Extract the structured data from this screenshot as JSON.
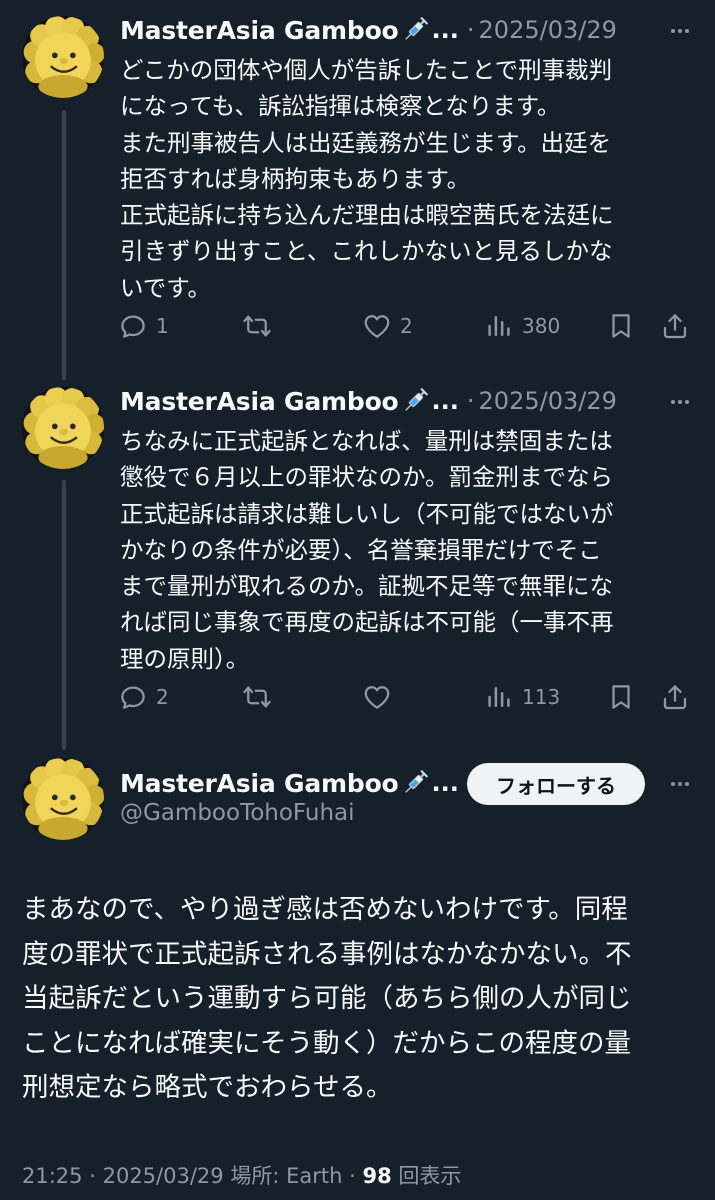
{
  "posts": [
    {
      "author_name": "MasterAsia Gamboo",
      "truncation": "...",
      "separator": "·",
      "date": "2025/03/29",
      "text": "どこかの団体や個人が告訴したことで刑事裁判\nになっても、訴訟指揮は検察となります。\nまた刑事被告人は出廷義務が生じます。出廷を\n拒否すれば身柄拘束もあります。\n正式起訴に持ち込んだ理由は暇空茜氏を法廷に\n引きずり出すこと、これしかないと見るしかな\nいです。",
      "replies": "1",
      "reposts": "",
      "likes": "2",
      "views": "380"
    },
    {
      "author_name": "MasterAsia Gamboo",
      "truncation": "...",
      "separator": "·",
      "date": "2025/03/29",
      "text": "ちなみに正式起訴となれば、量刑は禁固または\n懲役で６月以上の罪状なのか。罰金刑までなら\n正式起訴は請求は難しいし（不可能ではないが\nかなりの条件が必要）、名誉棄損罪だけでそこ\nまで量刑が取れるのか。証拠不足等で無罪にな\nれば同じ事象で再度の起訴は不可能（一事不再\n理の原則）。",
      "replies": "2",
      "reposts": "",
      "likes": "",
      "views": "113"
    }
  ],
  "main_post": {
    "author_name": "MasterAsia Gamboo",
    "truncation": "...",
    "handle": "@GambooTohoFuhai",
    "follow_label": "フォローする",
    "text": "まあなので、やり過ぎ感は否めないわけです。同程\n度の罪状で正式起訴される事例はなかなかない。不\n当起訴だという運動すら可能（あちら側の人が同じ\nことになれば確実にそう動く）だからこの程度の量\n刑想定なら略式でおわらせる。",
    "time": "21:25",
    "separator": "·",
    "date": "2025/03/29",
    "location": "場所: Earth",
    "separator2": "·",
    "views_count": "98",
    "views_label": "回表示"
  },
  "colors": {
    "background": "#15202b",
    "text": "#f7f9f9",
    "secondary": "#8b98a5",
    "thread_line": "#38444d",
    "follow_button_bg": "#eff3f4"
  },
  "icons": [
    "avatar-sunflower",
    "syringe-emoji",
    "more-icon",
    "reply-icon",
    "repost-icon",
    "like-icon",
    "views-icon",
    "bookmark-icon",
    "share-icon"
  ]
}
